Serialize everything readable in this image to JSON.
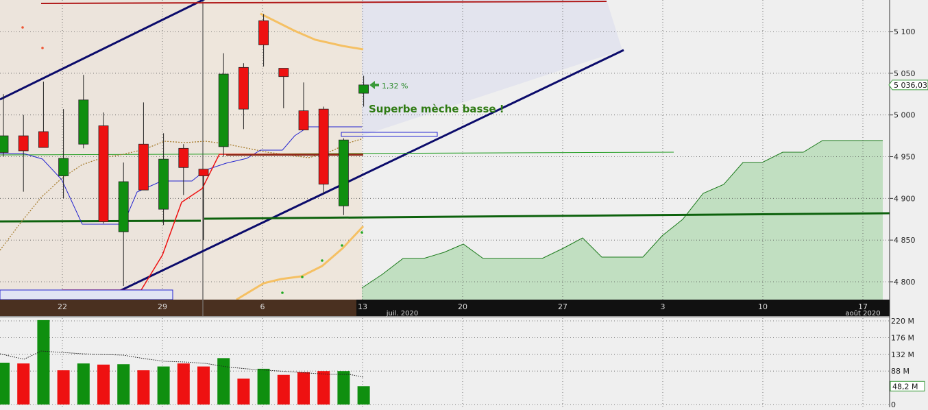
{
  "chart_data": [
    {
      "type": "candlestick",
      "title": "",
      "ylim": [
        4780,
        5130
      ],
      "y_ticks": [
        "5 100",
        "5 050",
        "5 000",
        "4 950",
        "4 900",
        "4 850",
        "4 800"
      ],
      "x_ticks": [
        {
          "label": "22"
        },
        {
          "label": "29"
        },
        {
          "label": "6"
        },
        {
          "label": "13"
        },
        {
          "label": "20"
        },
        {
          "label": "27"
        },
        {
          "label": "3"
        },
        {
          "label": "10"
        },
        {
          "label": "17"
        }
      ],
      "month_labels": [
        "juil. 2020",
        "août 2020"
      ],
      "candles": [
        {
          "o": 4955,
          "h": 5025,
          "l": 4950,
          "c": 4975,
          "color": "green"
        },
        {
          "o": 4975,
          "h": 5000,
          "l": 4908,
          "c": 4957,
          "color": "red"
        },
        {
          "o": 4980,
          "h": 5040,
          "l": 4980,
          "c": 4961,
          "color": "red"
        },
        {
          "o": 4927,
          "h": 5007,
          "l": 4900,
          "c": 4948,
          "color": "green"
        },
        {
          "o": 4965,
          "h": 5048,
          "l": 4960,
          "c": 5018,
          "color": "green"
        },
        {
          "o": 4987,
          "h": 5003,
          "l": 4870,
          "c": 4872,
          "color": "red"
        },
        {
          "o": 4860,
          "h": 4943,
          "l": 4795,
          "c": 4920,
          "color": "green"
        },
        {
          "o": 4965,
          "h": 5015,
          "l": 4910,
          "c": 4910,
          "color": "red"
        },
        {
          "o": 4887,
          "h": 4978,
          "l": 4868,
          "c": 4947,
          "color": "green"
        },
        {
          "o": 4960,
          "h": 4965,
          "l": 4904,
          "c": 4937,
          "color": "red"
        },
        {
          "o": 4935,
          "h": 4935,
          "l": 4850,
          "c": 4927,
          "color": "red"
        },
        {
          "o": 4962,
          "h": 5074,
          "l": 4950,
          "c": 5049,
          "color": "green"
        },
        {
          "o": 5057,
          "h": 5062,
          "l": 4983,
          "c": 5007,
          "color": "red"
        },
        {
          "o": 5113,
          "h": 5121,
          "l": 5058,
          "c": 5084,
          "color": "red"
        },
        {
          "o": 5056,
          "h": 5056,
          "l": 5008,
          "c": 5046,
          "color": "red"
        },
        {
          "o": 5005,
          "h": 5039,
          "l": 4985,
          "c": 4982,
          "color": "red"
        },
        {
          "o": 5007,
          "h": 5010,
          "l": 4905,
          "c": 4917,
          "color": "red"
        },
        {
          "o": 4891,
          "h": 4972,
          "l": 4880,
          "c": 4970,
          "color": "green"
        },
        {
          "o": 5026,
          "h": 5047,
          "l": 5010,
          "c": 5036,
          "color": "green"
        }
      ],
      "last_price": "5 036,03",
      "change_label": "1,32 %",
      "annotation": "Superbe mèche basse !",
      "colors": {
        "up": "#0f8f0f",
        "down": "#ee1111",
        "channel": "#0b0b6b",
        "ichimoku": "#1a7a1a",
        "cloud": "#b8dcb8"
      }
    },
    {
      "type": "bar",
      "title": "",
      "ylim": [
        0,
        220
      ],
      "y_ticks": [
        "220 M",
        "176 M",
        "132 M",
        "88 M",
        "0"
      ],
      "series": [
        {
          "values": [
            110,
            108,
            222,
            90,
            108,
            105,
            106,
            90,
            100,
            108,
            100,
            122,
            68,
            94,
            78,
            85,
            88,
            88,
            48.2
          ],
          "colors": [
            "green",
            "red",
            "green",
            "red",
            "green",
            "red",
            "green",
            "red",
            "green",
            "red",
            "red",
            "green",
            "red",
            "green",
            "red",
            "red",
            "red",
            "green",
            "green"
          ]
        }
      ],
      "last_value": "48,2 M"
    }
  ]
}
